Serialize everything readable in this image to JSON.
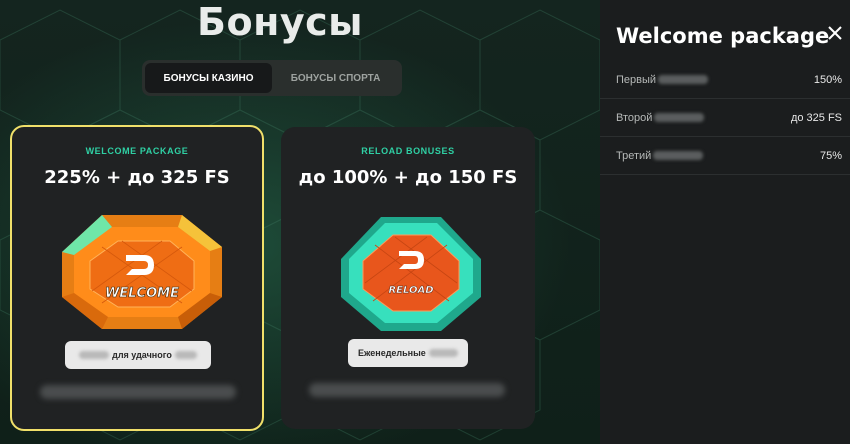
{
  "page": {
    "title": "Бонусы",
    "tabs": [
      {
        "label": "Бонусы казино",
        "active": true
      },
      {
        "label": "Бонусы спорта",
        "active": false
      }
    ]
  },
  "cards": [
    {
      "eyebrow": "WELCOME PACKAGE",
      "title": "225% + до 325 FS",
      "image_text": "WELCOME",
      "pill_label": "для удачного",
      "highlighted": true,
      "accent": "#f0e06a"
    },
    {
      "eyebrow": "RELOAD BONUSES",
      "title": "до 100% + до 150 FS",
      "image_text": "RELOAD",
      "pill_label": "Еженедельные",
      "highlighted": false
    }
  ],
  "panel": {
    "title": "Welcome package",
    "close_icon": "close-icon",
    "rows": [
      {
        "label": "Первый",
        "value": "150%"
      },
      {
        "label": "Второй",
        "value": "до 325 FS"
      },
      {
        "label": "Третий",
        "value": "75%"
      }
    ]
  },
  "colors": {
    "accent_teal": "#2fd0a4",
    "highlight_border": "#f0e06a",
    "card_bg": "#202223",
    "panel_bg": "#1b1d1e"
  }
}
